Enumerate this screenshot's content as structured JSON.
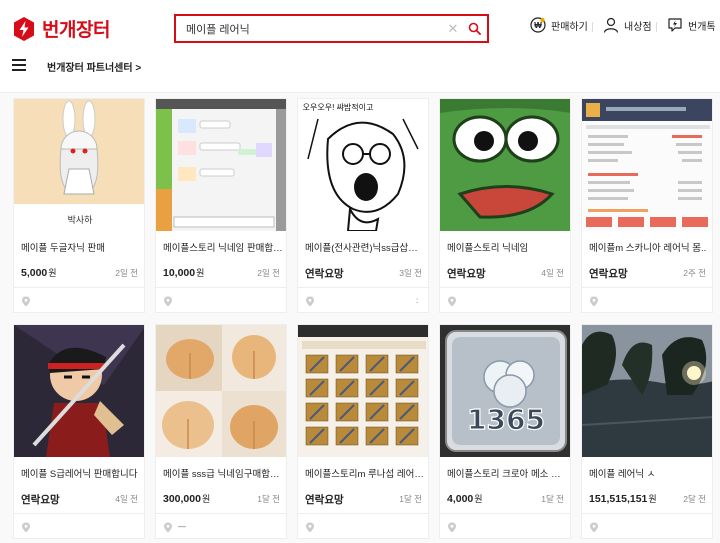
{
  "header": {
    "logo_text": "번개장터",
    "search": {
      "value": "메이플 레어닉",
      "clear_icon": "close-icon",
      "button_icon": "search-icon"
    },
    "utils": [
      {
        "label": "판매하기",
        "icon": "won-coin-icon"
      },
      {
        "label": "내상점",
        "icon": "user-icon"
      },
      {
        "label": "번개톡",
        "icon": "chat-bolt-icon"
      }
    ]
  },
  "subnav": {
    "menu_icon": "hamburger-icon",
    "partner_center": "번개장터 파트너센터 >"
  },
  "products": [
    {
      "title": "메이플 두글자닉 판매",
      "price": "5,000",
      "won": "원",
      "time": "2일 전",
      "location": "",
      "thumb_caption": "박사하"
    },
    {
      "title": "메이플스토리 닉네임 판매합니다",
      "price": "10,000",
      "won": "원",
      "time": "2일 전",
      "location": ""
    },
    {
      "title": "메이플(전사관련)닉ss급삽니다",
      "price": "연락요망",
      "won": "",
      "time": "3일 전",
      "location": ":",
      "thumb_caption": "오우오우! 쌰밤적이고"
    },
    {
      "title": "메이플스토리 닉네임",
      "price": "연락요망",
      "won": "",
      "time": "4일 전",
      "location": ""
    },
    {
      "title": "메이플m 스카니아 레어닉 몸..",
      "price": "연락요망",
      "won": "",
      "time": "2주 전",
      "location": ""
    },
    {
      "title": "메이플 S급레어닉 판매합니다",
      "price": "연락요망",
      "won": "",
      "time": "4일 전",
      "location": ""
    },
    {
      "title": "메이플 sss급 닉네임구매합니다",
      "price": "300,000",
      "won": "원",
      "time": "1달 전",
      "location": "—"
    },
    {
      "title": "메이플스토리m 루나섭 레어닉네임",
      "price": "연락요망",
      "won": "",
      "time": "1달 전",
      "location": ""
    },
    {
      "title": "메이플스토리 크로아 메소 및 닉네임",
      "price": "4,000",
      "won": "원",
      "time": "1달 전",
      "location": "",
      "thumb_caption": "1365"
    },
    {
      "title": "메이플 레어닉 ㅅ",
      "price": "151,515,151",
      "won": "원",
      "time": "2달 전",
      "location": ""
    }
  ],
  "colors": {
    "brand": "#d80c18",
    "price": "#212121",
    "muted": "#888888"
  }
}
